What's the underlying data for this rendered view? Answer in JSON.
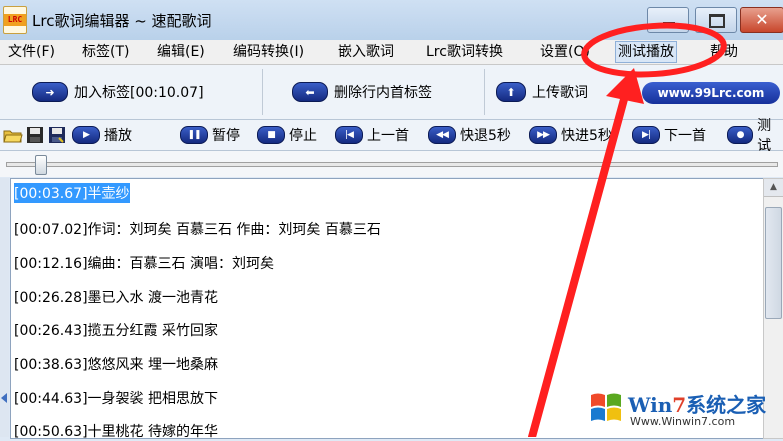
{
  "window": {
    "app_icon_text": "LRC",
    "title": "Lrc歌词编辑器 ~ 速配歌词",
    "close_glyph": "✕"
  },
  "menu": [
    {
      "label": "文件(F)"
    },
    {
      "label": "标签(T)"
    },
    {
      "label": "编辑(E)"
    },
    {
      "label": "编码转换(I)"
    },
    {
      "label": "嵌入歌词"
    },
    {
      "label": "Lrc歌词转换"
    },
    {
      "label": "设置(O)"
    },
    {
      "label": "测试播放"
    },
    {
      "label": "帮助"
    }
  ],
  "toolbar1": {
    "add_tag": "加入标签[00:10.07]",
    "delete_tag": "删除行内首标签",
    "upload": "上传歌词",
    "site": "www.99Lrc.com"
  },
  "toolbar2": {
    "play": "播放",
    "pause": "暂停",
    "stop": "停止",
    "prev": "上一首",
    "rewind": "快退5秒",
    "forward": "快进5秒",
    "next": "下一首",
    "test": "测试"
  },
  "lyrics": [
    "[00:03.67]半壶纱",
    "[00:07.02]作词：刘珂矣 百慕三石 作曲：刘珂矣 百慕三石",
    "[00:12.16]编曲：百慕三石 演唱：刘珂矣",
    "[00:26.28]墨已入水 渡一池青花",
    "[00:26.43]揽五分红霞 采竹回家",
    "[00:38.63]悠悠风来 埋一地桑麻",
    "[00:44.63]一身袈裟 把相思放下",
    "[00:50.63]十里桃花 待嫁的年华"
  ],
  "watermark": {
    "brand_a": "Win",
    "brand_b": "7",
    "brand_c": "系统之家",
    "url": "Www.Winwin7.com"
  },
  "colors": {
    "annotation_red": "#ff2020",
    "selection": "#3399ff"
  }
}
